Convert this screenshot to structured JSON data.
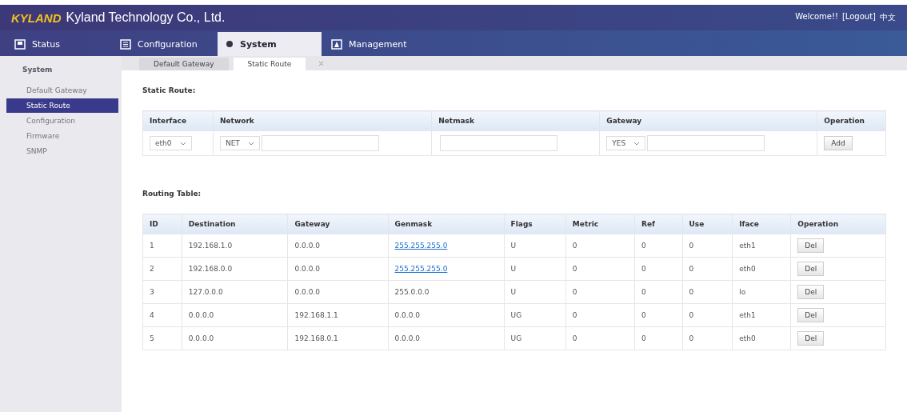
{
  "header": {
    "logo": "KYLAND",
    "title": "Kyland Technology Co., Ltd.",
    "user_links": [
      "Welcome!!",
      "[Logout]",
      "中文"
    ]
  },
  "nav_tabs": [
    {
      "label": "Status",
      "selected": false
    },
    {
      "label": "Configuration",
      "selected": false
    },
    {
      "label": "System",
      "selected": true
    },
    {
      "label": "Management",
      "selected": false
    }
  ],
  "sidebar": {
    "title": "System",
    "items": [
      {
        "label": "Default Gateway",
        "selected": false
      },
      {
        "label": "Static Route",
        "selected": true
      },
      {
        "label": "Configuration",
        "selected": false
      },
      {
        "label": "Firmware",
        "selected": false
      },
      {
        "label": "SNMP",
        "selected": false
      }
    ]
  },
  "page_tabs": [
    {
      "label": "Default Gateway",
      "selected": false
    },
    {
      "label": "Static Route",
      "selected": true
    }
  ],
  "static_route": {
    "title": "Static Route:",
    "columns": [
      "Interface",
      "Network",
      "Netmask",
      "Gateway",
      "Operation"
    ],
    "interface": "eth0",
    "network_type": "NET",
    "gateway_type": "YES",
    "button": "Add"
  },
  "routing_table": {
    "title": "Routing Table:",
    "columns": [
      "ID",
      "Destination",
      "Gateway",
      "Genmask",
      "Flags",
      "Metric",
      "Ref",
      "Use",
      "Iface",
      "Operation"
    ],
    "rows": [
      {
        "cells": [
          "1",
          "192.168.1.0",
          "0.0.0.0",
          "255.255.255.0",
          "U",
          "0",
          "0",
          "0",
          "eth1"
        ],
        "genmask_link": true,
        "button": "Del"
      },
      {
        "cells": [
          "2",
          "192.168.0.0",
          "0.0.0.0",
          "255.255.255.0",
          "U",
          "0",
          "0",
          "0",
          "eth0"
        ],
        "genmask_link": true,
        "button": "Del"
      },
      {
        "cells": [
          "3",
          "127.0.0.0",
          "0.0.0.0",
          "255.0.0.0",
          "U",
          "0",
          "0",
          "0",
          "lo"
        ],
        "genmask_link": false,
        "button": "Del"
      },
      {
        "cells": [
          "4",
          "0.0.0.0",
          "192.168.1.1",
          "0.0.0.0",
          "UG",
          "0",
          "0",
          "0",
          "eth1"
        ],
        "genmask_link": false,
        "button": "Del"
      },
      {
        "cells": [
          "5",
          "0.0.0.0",
          "192.168.0.1",
          "0.0.0.0",
          "UG",
          "0",
          "0",
          "0",
          "eth0"
        ],
        "genmask_link": false,
        "button": "Del"
      }
    ]
  }
}
